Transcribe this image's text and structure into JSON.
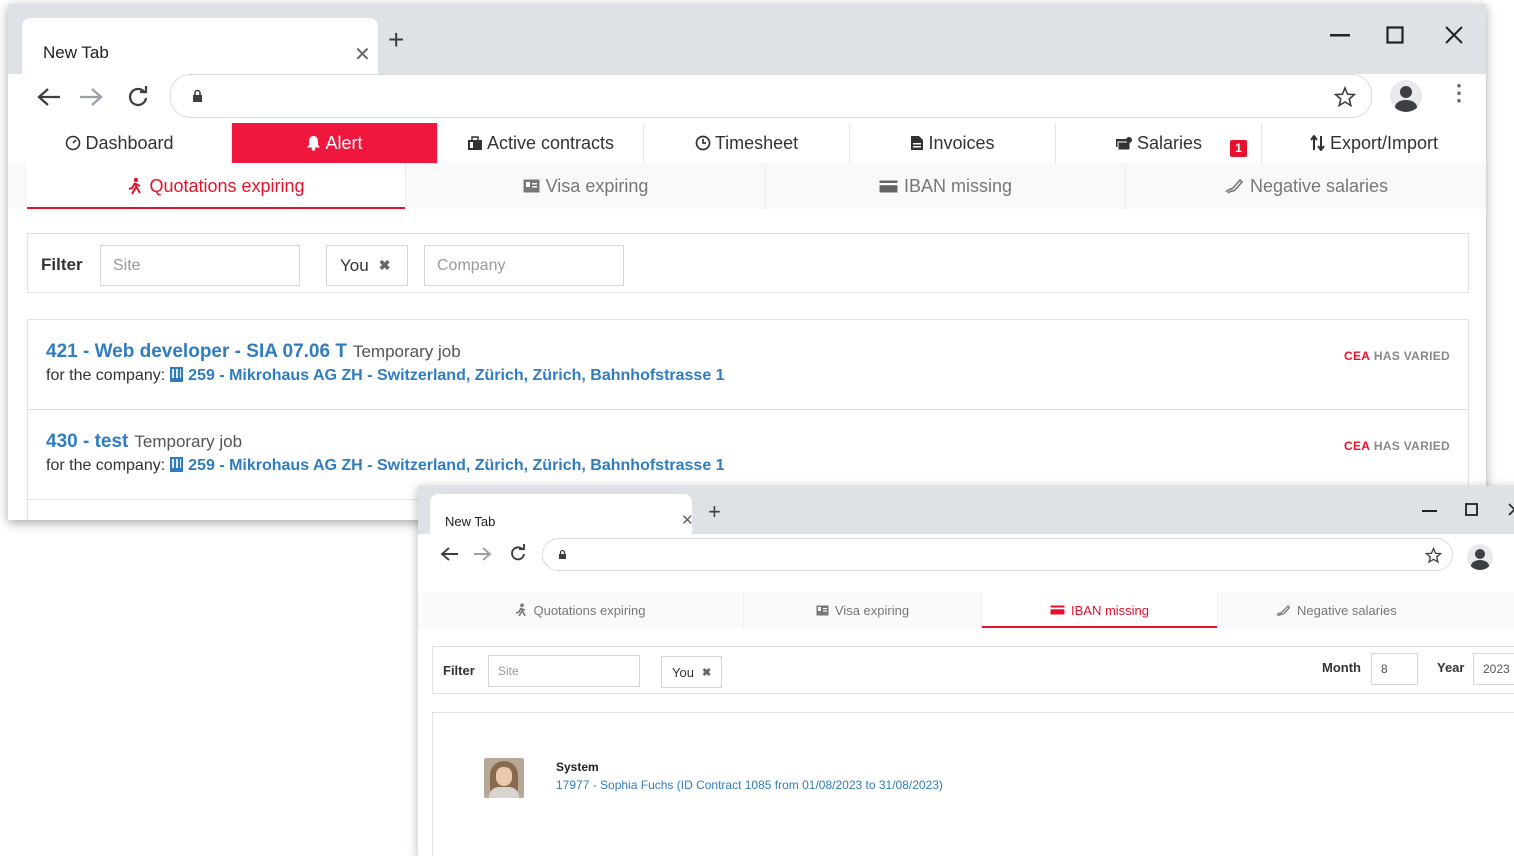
{
  "window1": {
    "tab_title": "New Tab",
    "tab_close": "✕",
    "new_tab": "+",
    "url": "",
    "nav": [
      {
        "label": "Dashboard",
        "icon": "dashboard-icon"
      },
      {
        "label": "Alert",
        "icon": "bell-icon",
        "active": true
      },
      {
        "label": "Active contracts",
        "icon": "briefcase-icon"
      },
      {
        "label": "Timesheet",
        "icon": "clock-icon"
      },
      {
        "label": "Invoices",
        "icon": "file-invoice-icon"
      },
      {
        "label": "Salaries",
        "icon": "money-icon",
        "badge": "1"
      },
      {
        "label": "Export/Import",
        "icon": "sort-icon"
      }
    ],
    "subtabs": [
      {
        "label": "Quotations expiring",
        "icon": "person-walking-icon",
        "active": true
      },
      {
        "label": "Visa expiring",
        "icon": "id-card-icon"
      },
      {
        "label": "IBAN missing",
        "icon": "credit-card-icon"
      },
      {
        "label": "Negative salaries",
        "icon": "signature-icon"
      }
    ],
    "filter": {
      "label": "Filter",
      "site_placeholder": "Site",
      "chip": "You",
      "chip_remove": "✖",
      "company_placeholder": "Company"
    },
    "alerts": [
      {
        "link": "421 - Web developer - SIA 07.06 T",
        "type": "Temporary job",
        "company_prefix": "for the company:",
        "company": "259 - Mikrohaus AG ZH - Switzerland, Zürich, Zürich, Bahnhofstrasse 1",
        "status_a": "CEA",
        "status_b": "HAS VARIED"
      },
      {
        "link": "430 - test",
        "type": "Temporary job",
        "company_prefix": "for the company:",
        "company": "259 - Mikrohaus AG ZH - Switzerland, Zürich, Zürich, Bahnhofstrasse 1",
        "status_a": "CEA",
        "status_b": "HAS VARIED"
      }
    ]
  },
  "window2": {
    "tab_title": "New Tab",
    "tab_close": "✕",
    "new_tab": "+",
    "url": "",
    "subtabs": [
      {
        "label": "Quotations expiring",
        "icon": "person-walking-icon"
      },
      {
        "label": "Visa expiring",
        "icon": "id-card-icon"
      },
      {
        "label": "IBAN missing",
        "icon": "credit-card-icon",
        "active": true
      },
      {
        "label": "Negative salaries",
        "icon": "signature-icon"
      }
    ],
    "filter": {
      "label": "Filter",
      "site_placeholder": "Site",
      "chip": "You",
      "chip_remove": "✖",
      "month_label": "Month",
      "month_value": "8",
      "year_label": "Year",
      "year_value": "2023"
    },
    "entry": {
      "title": "System",
      "text": "17977 - Sophia Fuchs (ID Contract 1085 from 01/08/2023 to 31/08/2023)"
    }
  },
  "colors": {
    "accent_red": "#f0173f",
    "link_blue": "#2f7dc0",
    "chrome_gray": "#dee1e6"
  }
}
